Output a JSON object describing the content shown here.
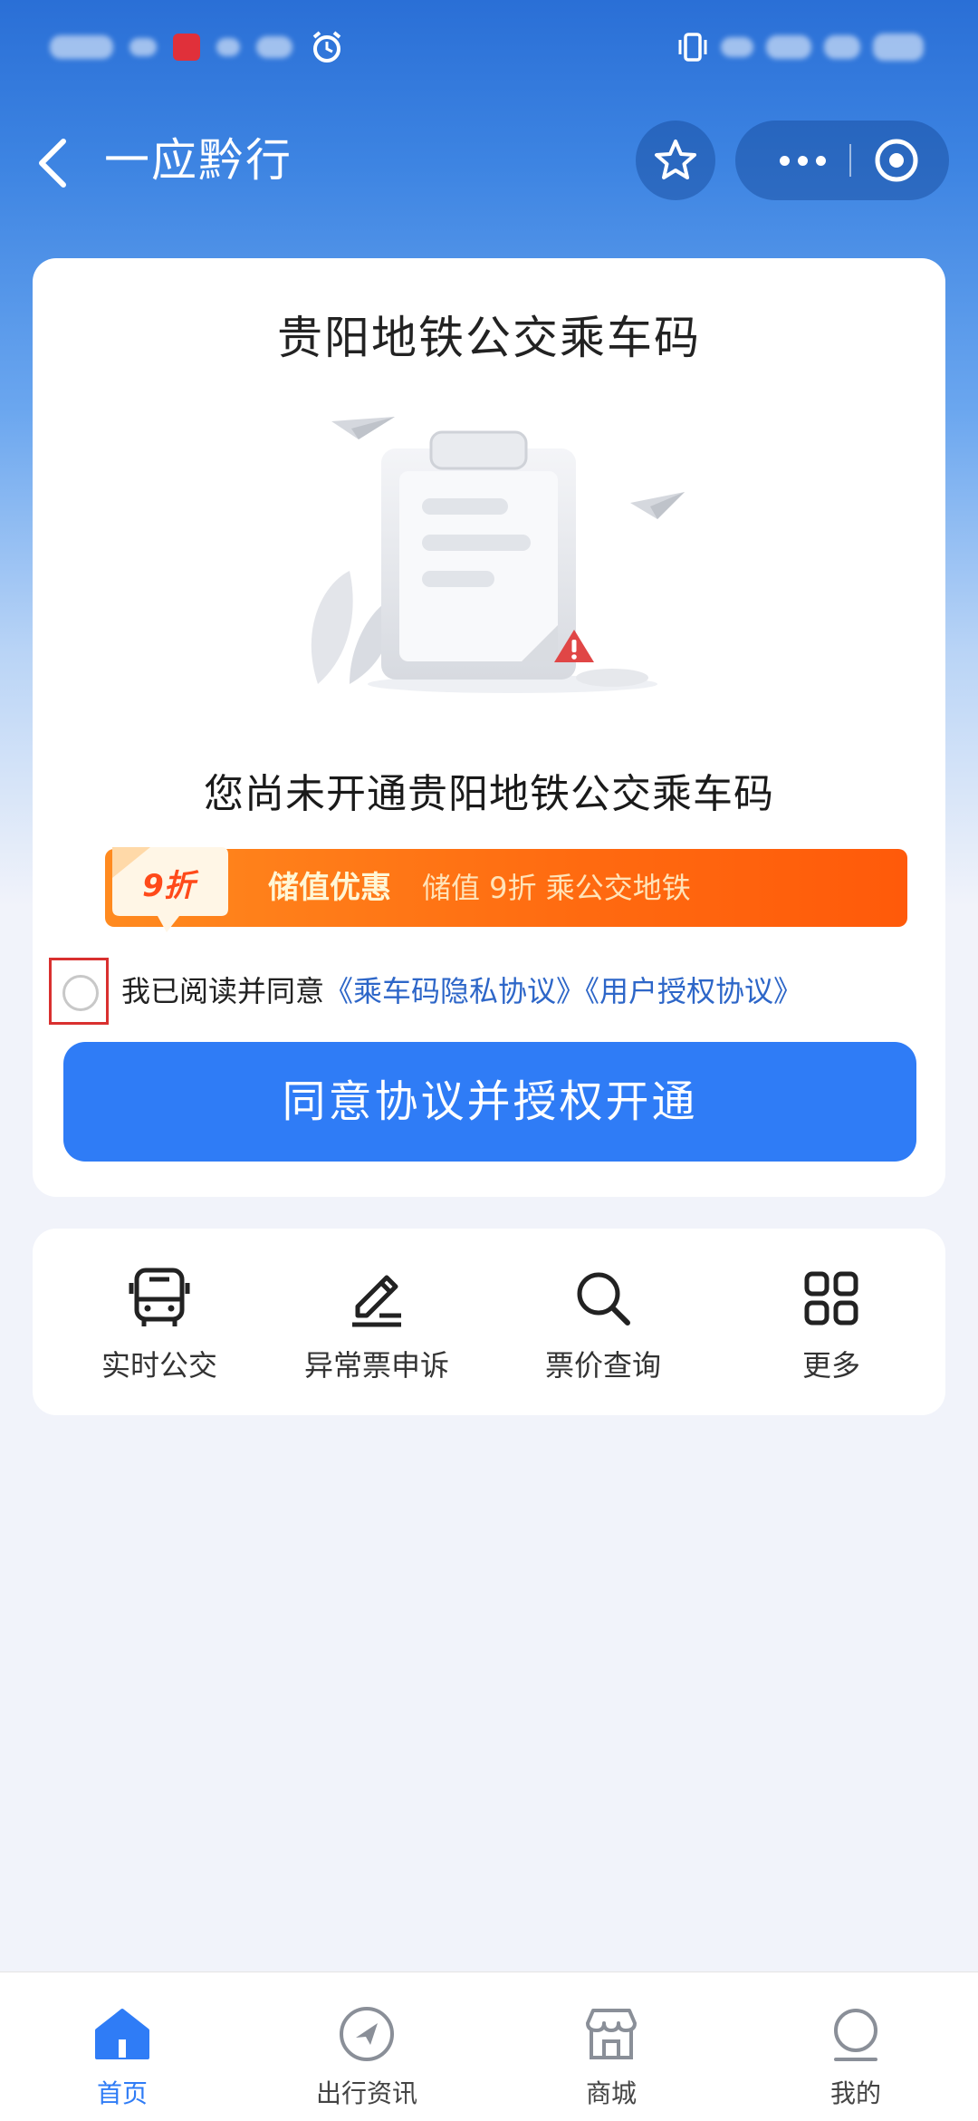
{
  "header": {
    "title": "一应黔行"
  },
  "card": {
    "title": "贵阳地铁公交乘车码",
    "empty_text": "您尚未开通贵阳地铁公交乘车码",
    "promo": {
      "tag": "9折",
      "strong": "储值优惠",
      "sub": "储值 9折 乘公交地铁"
    },
    "agreement": {
      "prefix": "我已阅读并同意",
      "link1": "《乘车码隐私协议》",
      "link2": "《用户授权协议》",
      "checked": false
    },
    "open_button": "同意协议并授权开通"
  },
  "services": [
    {
      "label": "实时公交",
      "icon": "bus-icon"
    },
    {
      "label": "异常票申诉",
      "icon": "edit-icon"
    },
    {
      "label": "票价查询",
      "icon": "search-icon"
    },
    {
      "label": "更多",
      "icon": "grid-icon"
    }
  ],
  "nav": [
    {
      "label": "首页",
      "icon": "home-icon",
      "active": true
    },
    {
      "label": "出行资讯",
      "icon": "compass-icon",
      "active": false
    },
    {
      "label": "商城",
      "icon": "store-icon",
      "active": false
    },
    {
      "label": "我的",
      "icon": "profile-icon",
      "active": false
    }
  ],
  "colors": {
    "primary": "#2f7cf6",
    "promo": "#ff6a10",
    "link": "#2d66c8"
  }
}
